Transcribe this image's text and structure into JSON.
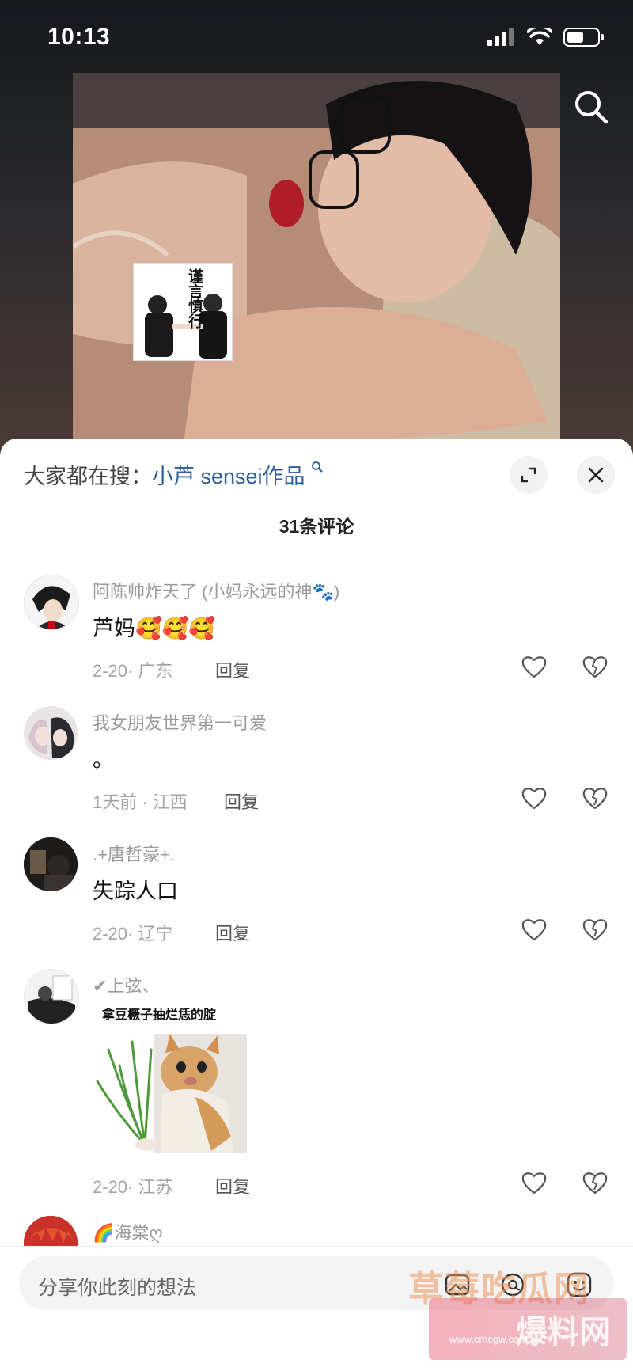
{
  "status_bar": {
    "time": "10:13"
  },
  "video": {
    "sticker_text": "谨言慎行"
  },
  "sheet": {
    "hot_search_prefix": "大家都在搜：",
    "hot_search_link": "小芦 sensei作品",
    "comment_count": "31条评论"
  },
  "comments": [
    {
      "name": "阿陈帅炸天了 (小妈永远的神🐾)",
      "text": "芦妈🥰🥰🥰",
      "date": "2-20",
      "location": "广东",
      "reply": "回复"
    },
    {
      "name": "我女朋友世界第一可爱",
      "text": "。",
      "date": "1天前",
      "location": "江西",
      "reply": "回复"
    },
    {
      "name": ".+唐哲豪+.",
      "text": "失踪人口",
      "date": "2-20",
      "location": "辽宁",
      "reply": "回复"
    },
    {
      "name": "✔上弦、",
      "meme_caption": "拿豆橛子抽烂恁的腚",
      "date": "2-20",
      "location": "江苏",
      "reply": "回复"
    },
    {
      "name": "🌈海棠ღ"
    }
  ],
  "input": {
    "placeholder": "分享你此刻的想法"
  },
  "watermark": {
    "line1": "草莓吃瓜网",
    "line2": "爆料网",
    "url": "www.cmcgw.com"
  },
  "colors": {
    "link": "#2a5d9a",
    "muted": "#9a9a9a",
    "sheet_bg": "#ffffff",
    "top_bg": "#1d1f23"
  },
  "icons": [
    "search-icon",
    "expand-icon",
    "close-icon",
    "heart-icon",
    "broken-heart-icon",
    "image-icon",
    "emoji-icon",
    "at-icon"
  ]
}
